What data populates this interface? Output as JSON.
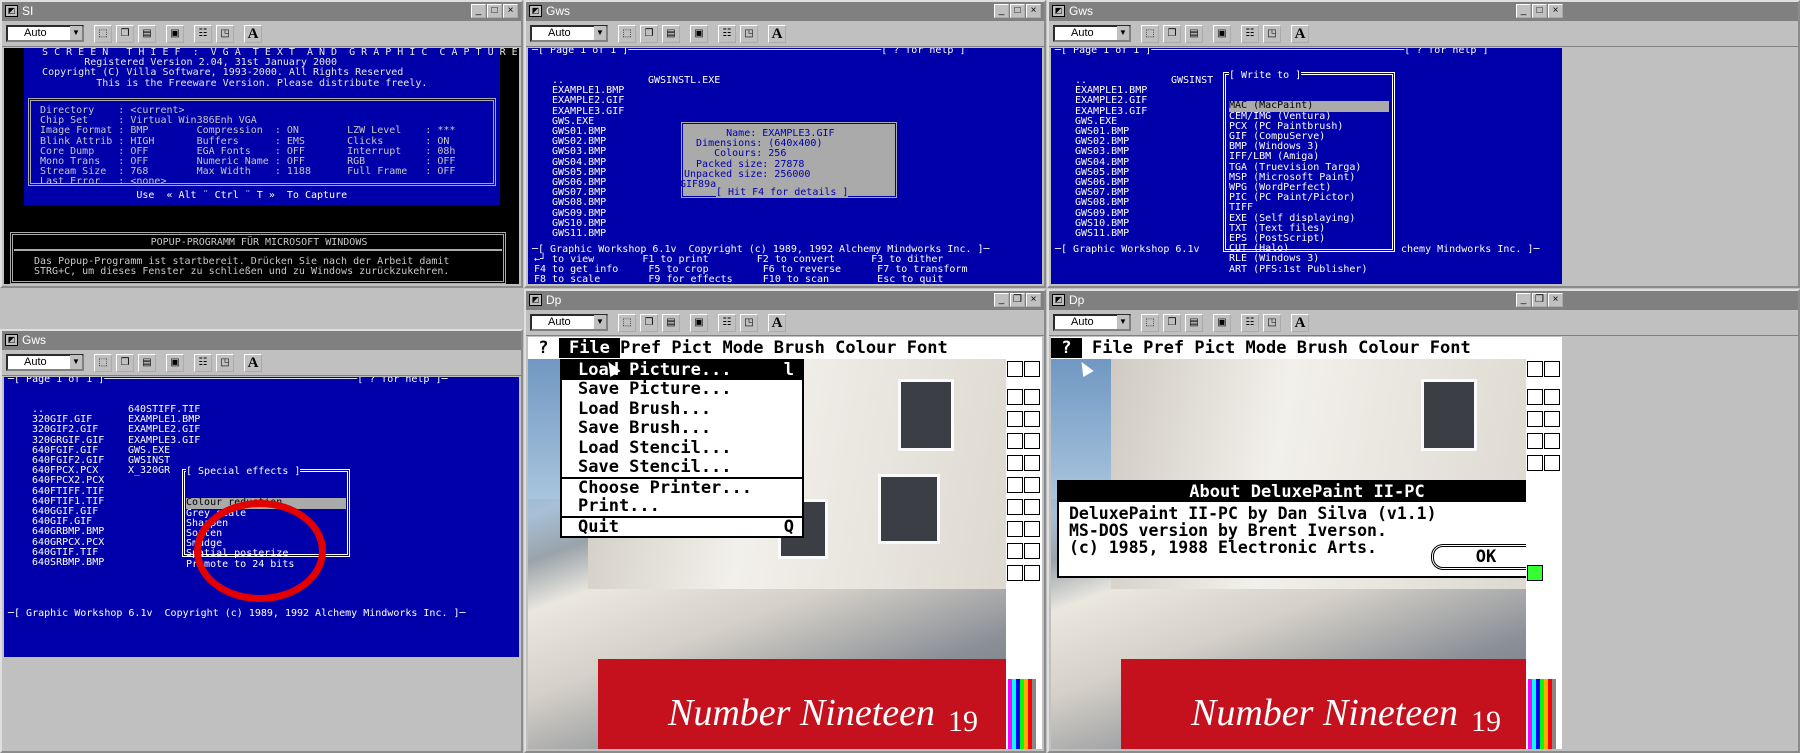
{
  "windows": {
    "w1": "SI",
    "w2": "Gws",
    "w3": "Gws",
    "w4": "Gws",
    "w5": "Dp",
    "w6": "Dp"
  },
  "toolbar": {
    "auto": "Auto",
    "a": "A"
  },
  "st": {
    "head": [
      "   S C R E E N   T H I E F  :  V G A  T E X T  A N D  G R A P H I C  C A P T U R E",
      "          Registered Version 2.04, 31st January 2000",
      "   Copyright (C) Villa Software, 1993-2000. All Rights Reserved",
      "",
      "            This is the Freeware Version. Please distribute freely."
    ],
    "info": [
      "  Directory    : <current>",
      "  Chip Set     : Virtual Win386Enh VGA",
      "  Image Format : BMP        Compression  : ON        LZW Level    : ***",
      "  Blink Attrib : HIGH       Buffers      : EMS       Clicks       : ON",
      "  Core Dump    : OFF        EGA Fonts    : OFF       Interrupt    : 08h",
      "  Mono Trans   : OFF        Numeric Name : OFF       RGB          : OFF",
      "  Stream Size  : 768        Max Width    : 1188      Full Frame   : OFF",
      "  Last Error   : <none>"
    ],
    "use": "                  Use  « Alt ¨ Ctrl ¨ T »  To Capture",
    "popup_title": "POPUP-PROGRAMM FÜR MICROSOFT WINDOWS",
    "popup_body": [
      "Das Popup-Programm ist startbereit. Drücken Sie nach der Arbeit damit",
      "STRG+C, um dieses Fenster zu schließen und zu Windows zurückzukehren."
    ]
  },
  "gws1": {
    "top": "─[ Page 1 of 1 ]──────────────────────────────────────────[ ? for help ]",
    "files": [
      "..",
      "EXAMPLE1.BMP",
      "EXAMPLE2.GIF",
      "EXAMPLE3.GIF",
      "GWS.EXE",
      "GWS01.BMP",
      "GWS02.BMP",
      "GWS03.BMP",
      "GWS04.BMP",
      "GWS05.BMP",
      "GWS06.BMP",
      "GWS07.BMP",
      "GWS08.BMP",
      "GWS09.BMP",
      "GWS10.BMP",
      "GWS11.BMP"
    ],
    "col2": "GWSINSTL.EXE",
    "info": [
      "       Name: EXAMPLE3.GIF",
      "  Dimensions: (640x400)",
      "     Colours: 256",
      "  Packed size: 27878",
      "Unpacked size: 256000",
      "GIF89a"
    ],
    "hint": "[ Hit F4 for details ]",
    "bottom": "─[ Graphic Workshop 6.1v  Copyright (c) 1989, 1992 Alchemy Mindworks Inc. ]─",
    "keys": [
      "←┘ to view        F1 to print        F2 to convert      F3 to dither",
      "F4 to get info     F5 to crop         F6 to reverse      F7 to transform",
      "F8 to scale        F9 for effects     F10 to scan        Esc to quit"
    ]
  },
  "gws2": {
    "col2": "GWSINST",
    "write_title": "[ Write to ]",
    "formats": [
      "MAC (MacPaint)",
      "CEM/IMG (Ventura)",
      "PCX (PC Paintbrush)",
      "GIF (CompuServe)",
      "BMP (Windows 3)",
      "IFF/LBM (Amiga)",
      "TGA (Truevision Targa)",
      "MSP (Microsoft Paint)",
      "WPG (WordPerfect)",
      "PIC (PC Paint/Pictor)",
      "TIFF",
      "EXE (Self displaying)",
      "TXT (Text files)",
      "EPS (PostScript)",
      "CUT (Halo)",
      "RLE (Windows 3)",
      "ART (PFS:1st Publisher)"
    ],
    "bottom": "─[ Graphic Workshop 6.1v",
    "bottom_r": "chemy Mindworks Inc. ]─"
  },
  "gws3": {
    "top": "─[ Page 1 of 1 ]──────────────────────────────────────────[ ? for help ]─",
    "col1": [
      "..",
      "320GIF.GIF",
      "320GIF2.GIF",
      "320GRGIF.GIF",
      "640FGIF.GIF",
      "640FGIF2.GIF",
      "640FPCX.PCX",
      "640FPCX2.PCX",
      "640FTIFF.TIF",
      "640FTIF1.TIF",
      "640GGIF.GIF",
      "640GIF.GIF",
      "640GRBMP.BMP",
      "640GRPCX.PCX",
      "640GTIF.TIF",
      "640SRBMP.BMP"
    ],
    "col2": [
      "640STIFF.TIF",
      "EXAMPLE1.BMP",
      "EXAMPLE2.GIF",
      "EXAMPLE3.GIF",
      "GWS.EXE",
      "GWSINST",
      "X_320GR"
    ],
    "fx_title": "[ Special effects ]",
    "fx": [
      "Colour reduction",
      "Grey scale",
      "Sharpen",
      "Soften",
      "Smudge",
      "Spatial posterize",
      "Promote to 24 bits"
    ],
    "bottom": "─[ Graphic Workshop 6.1v  Copyright (c) 1989, 1992 Alchemy Mindworks Inc. ]─"
  },
  "dp": {
    "menubar": [
      " ? ",
      " File ",
      "Pref ",
      "Pict ",
      "Mode ",
      "Brush ",
      "Colour ",
      "Font"
    ],
    "file_menu": [
      "Load Picture...",
      "Save Picture...",
      "Load Brush...",
      "Save Brush...",
      "Load Stencil...",
      "Save Stencil...",
      "Choose Printer...",
      "Print...",
      "Quit"
    ],
    "shortcuts": {
      "load": "l",
      "quit": "Q"
    },
    "sign": "Number Nineteen",
    "sign_num": "19",
    "about_title": "About DeluxePaint II-PC",
    "about_lines": [
      "DeluxePaint II-PC by Dan Silva (v1.1)",
      "MS-DOS version by Brent Iverson.",
      "(c) 1985, 1988 Electronic Arts."
    ],
    "ok": "OK"
  }
}
